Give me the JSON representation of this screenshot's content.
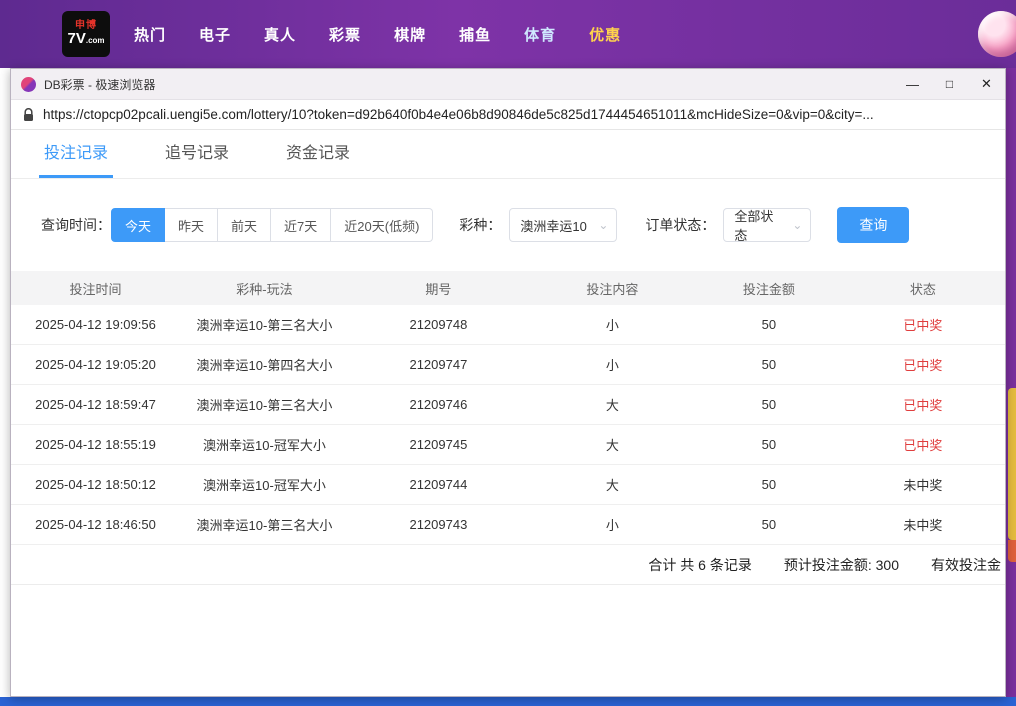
{
  "nav": {
    "logo": {
      "top": "申博",
      "main": "7V",
      "suffix": ".com"
    },
    "items": [
      {
        "label": "热门",
        "color": "#ffffff"
      },
      {
        "label": "电子",
        "color": "#ffffff"
      },
      {
        "label": "真人",
        "color": "#ffffff"
      },
      {
        "label": "彩票",
        "color": "#ffffff"
      },
      {
        "label": "棋牌",
        "color": "#ffffff"
      },
      {
        "label": "捕鱼",
        "color": "#ffffff"
      },
      {
        "label": "体育",
        "color": "#cfe8ff"
      },
      {
        "label": "优惠",
        "color": "#ffd34d"
      }
    ]
  },
  "browser": {
    "title": "DB彩票 - 极速浏览器",
    "url": "https://ctopcp02pcali.uengi5e.com/lottery/10?token=d92b640f0b4e4e06b8d90846de5c825d1744454651011&mcHideSize=0&vip=0&city=...",
    "controls": {
      "minimize": "—",
      "maximize": "□",
      "close": "✕"
    }
  },
  "tabs": [
    {
      "label": "投注记录",
      "active": true
    },
    {
      "label": "追号记录",
      "active": false
    },
    {
      "label": "资金记录",
      "active": false
    }
  ],
  "filters": {
    "time_label": "查询时间：",
    "time_options": [
      "今天",
      "昨天",
      "前天",
      "近7天",
      "近20天(低频)"
    ],
    "time_active": "今天",
    "lottery_label": "彩种：",
    "lottery_value": "澳洲幸运10",
    "status_label": "订单状态：",
    "status_value": "全部状态",
    "query_label": "查询",
    "chevron": "⌄"
  },
  "table": {
    "headers": [
      "投注时间",
      "彩种-玩法",
      "期号",
      "投注内容",
      "投注金额",
      "状态"
    ],
    "rows": [
      {
        "time": "2025-04-12 19:09:56",
        "game": "澳洲幸运10-第三名大小",
        "issue": "21209748",
        "content": "小",
        "amount": "50",
        "status": "已中奖",
        "won": true
      },
      {
        "time": "2025-04-12 19:05:20",
        "game": "澳洲幸运10-第四名大小",
        "issue": "21209747",
        "content": "小",
        "amount": "50",
        "status": "已中奖",
        "won": true
      },
      {
        "time": "2025-04-12 18:59:47",
        "game": "澳洲幸运10-第三名大小",
        "issue": "21209746",
        "content": "大",
        "amount": "50",
        "status": "已中奖",
        "won": true
      },
      {
        "time": "2025-04-12 18:55:19",
        "game": "澳洲幸运10-冠军大小",
        "issue": "21209745",
        "content": "大",
        "amount": "50",
        "status": "已中奖",
        "won": true
      },
      {
        "time": "2025-04-12 18:50:12",
        "game": "澳洲幸运10-冠军大小",
        "issue": "21209744",
        "content": "大",
        "amount": "50",
        "status": "未中奖",
        "won": false
      },
      {
        "time": "2025-04-12 18:46:50",
        "game": "澳洲幸运10-第三名大小",
        "issue": "21209743",
        "content": "小",
        "amount": "50",
        "status": "未中奖",
        "won": false
      }
    ]
  },
  "summary": {
    "total": "合计 共 6 条记录",
    "expected": "预计投注金额: 300",
    "valid": "有效投注金"
  },
  "colors": {
    "accent_blue": "#3d9af8",
    "won_status": "#e03e3e"
  }
}
